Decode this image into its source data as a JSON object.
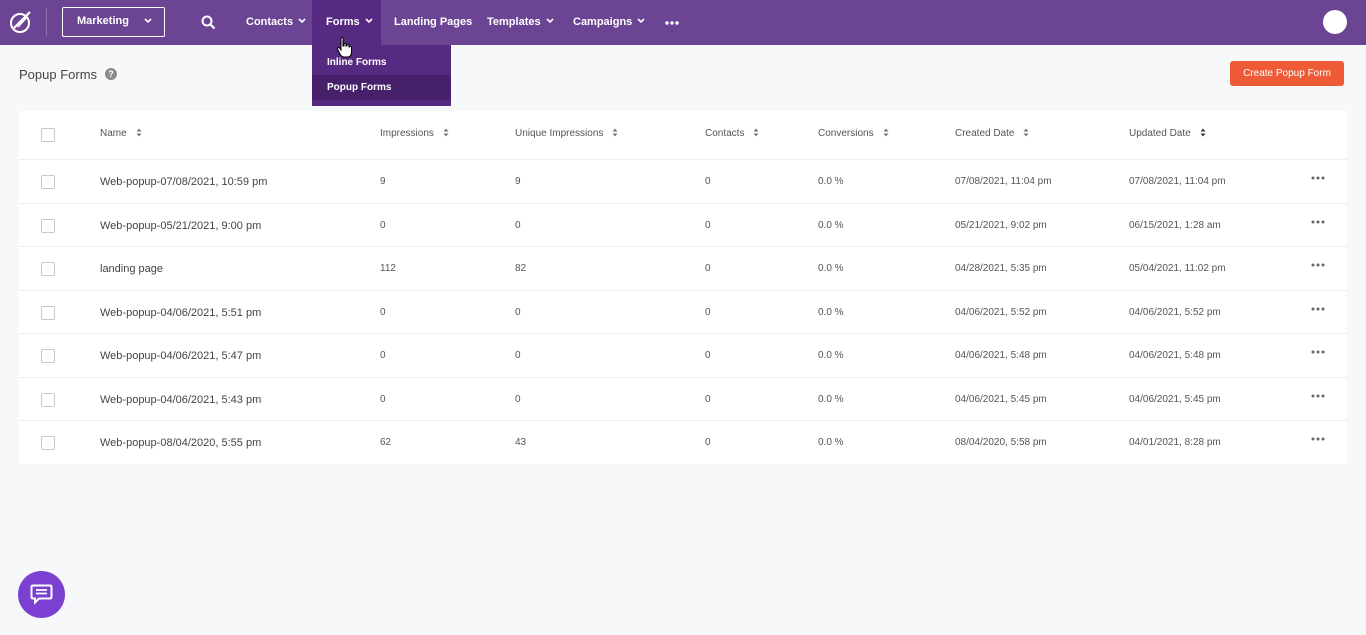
{
  "nav": {
    "app_switcher": "Marketing",
    "items": [
      {
        "label": "Contacts",
        "has_menu": true
      },
      {
        "label": "Forms",
        "has_menu": true,
        "active": true
      },
      {
        "label": "Landing Pages",
        "has_menu": false
      },
      {
        "label": "Templates",
        "has_menu": true
      },
      {
        "label": "Campaigns",
        "has_menu": true
      }
    ],
    "dropdown_items": [
      {
        "label": "Inline Forms"
      },
      {
        "label": "Popup Forms",
        "selected": true
      }
    ]
  },
  "page": {
    "title": "Popup Forms",
    "help_glyph": "?",
    "create_button": "Create Popup Form"
  },
  "table": {
    "columns": [
      "Name",
      "Impressions",
      "Unique Impressions",
      "Contacts",
      "Conversions",
      "Created Date",
      "Updated Date"
    ],
    "rows": [
      {
        "name": "Web-popup-07/08/2021, 10:59 pm",
        "impressions": "9",
        "unique": "9",
        "contacts": "0",
        "conversions": "0.0 %",
        "created": "07/08/2021, 11:04 pm",
        "updated": "07/08/2021, 11:04 pm"
      },
      {
        "name": "Web-popup-05/21/2021, 9:00 pm",
        "impressions": "0",
        "unique": "0",
        "contacts": "0",
        "conversions": "0.0 %",
        "created": "05/21/2021, 9:02 pm",
        "updated": "06/15/2021, 1:28 am"
      },
      {
        "name": "landing page",
        "impressions": "112",
        "unique": "82",
        "contacts": "0",
        "conversions": "0.0 %",
        "created": "04/28/2021, 5:35 pm",
        "updated": "05/04/2021, 11:02 pm"
      },
      {
        "name": "Web-popup-04/06/2021, 5:51 pm",
        "impressions": "0",
        "unique": "0",
        "contacts": "0",
        "conversions": "0.0 %",
        "created": "04/06/2021, 5:52 pm",
        "updated": "04/06/2021, 5:52 pm"
      },
      {
        "name": "Web-popup-04/06/2021, 5:47 pm",
        "impressions": "0",
        "unique": "0",
        "contacts": "0",
        "conversions": "0.0 %",
        "created": "04/06/2021, 5:48 pm",
        "updated": "04/06/2021, 5:48 pm"
      },
      {
        "name": "Web-popup-04/06/2021, 5:43 pm",
        "impressions": "0",
        "unique": "0",
        "contacts": "0",
        "conversions": "0.0 %",
        "created": "04/06/2021, 5:45 pm",
        "updated": "04/06/2021, 5:45 pm"
      },
      {
        "name": "Web-popup-08/04/2020, 5:55 pm",
        "impressions": "62",
        "unique": "43",
        "contacts": "0",
        "conversions": "0.0 %",
        "created": "08/04/2020, 5:58 pm",
        "updated": "04/01/2021, 8:28 pm"
      }
    ]
  },
  "colors": {
    "nav_bg": "#6b4593",
    "nav_active": "#552a80",
    "primary_button": "#ef5b36",
    "chat_button": "#7b3fd2"
  }
}
